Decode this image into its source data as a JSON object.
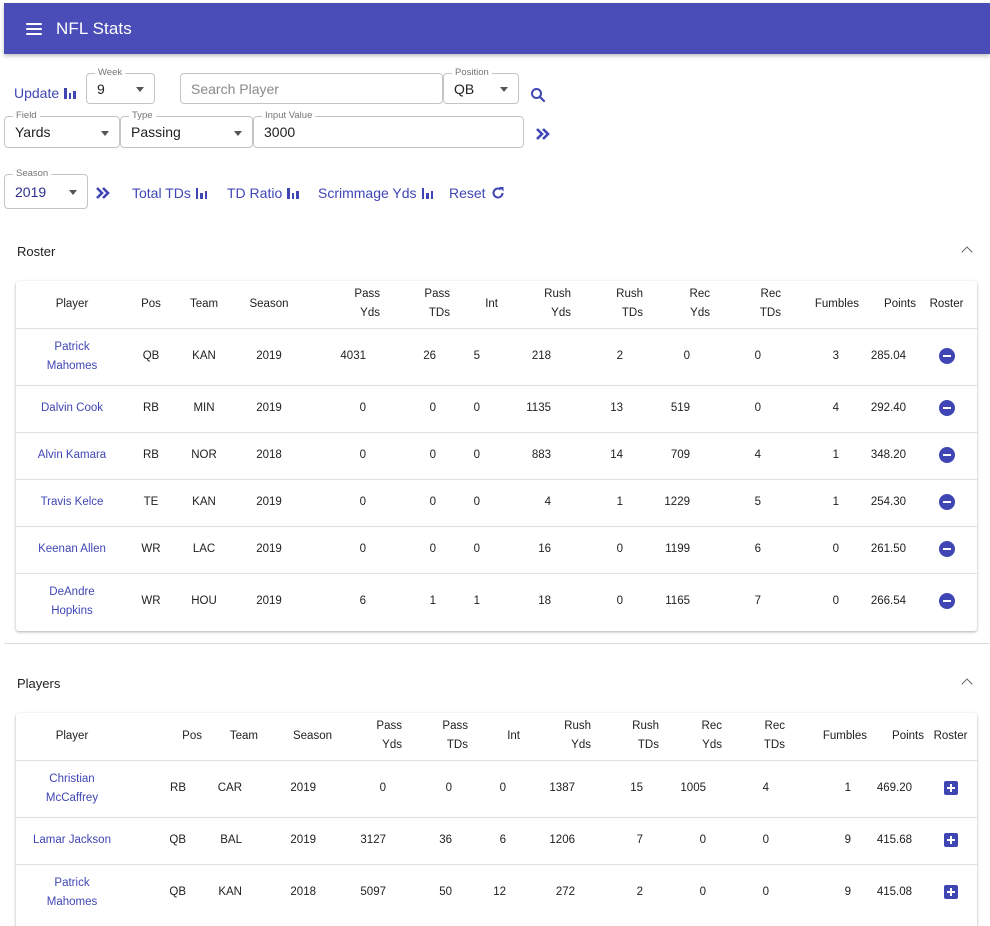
{
  "app": {
    "title": "NFL Stats"
  },
  "controls": {
    "update_label": "Update",
    "week": {
      "label": "Week",
      "value": "9"
    },
    "search": {
      "placeholder": "Search Player"
    },
    "position": {
      "label": "Position",
      "value": "QB"
    },
    "field": {
      "label": "Field",
      "value": "Yards"
    },
    "type": {
      "label": "Type",
      "value": "Passing"
    },
    "input_value": {
      "label": "Input Value",
      "value": "3000"
    },
    "season": {
      "label": "Season",
      "value": "2019"
    },
    "total_tds_label": "Total TDs",
    "td_ratio_label": "TD Ratio",
    "scrimmage_yds_label": "Scrimmage Yds",
    "reset_label": "Reset"
  },
  "columns": {
    "player": "Player",
    "pos": "Pos",
    "team": "Team",
    "season": "Season",
    "pass_yds_1": "Pass",
    "pass_yds_2": "Yds",
    "pass_tds_1": "Pass",
    "pass_tds_2": "TDs",
    "int": "Int",
    "rush_yds_1": "Rush",
    "rush_yds_2": "Yds",
    "rush_tds_1": "Rush",
    "rush_tds_2": "TDs",
    "rec_yds_1": "Rec",
    "rec_yds_2": "Yds",
    "rec_tds_1": "Rec",
    "rec_tds_2": "TDs",
    "fumbles": "Fumbles",
    "points": "Points",
    "roster": "Roster"
  },
  "roster": {
    "title": "Roster",
    "rows": [
      {
        "name1": "Patrick",
        "name2": "Mahomes",
        "pos": "QB",
        "team": "KAN",
        "season": "2019",
        "pass_yds": "4031",
        "pass_tds": "26",
        "int": "5",
        "rush_yds": "218",
        "rush_tds": "2",
        "rec_yds": "0",
        "rec_tds": "0",
        "fumbles": "3",
        "points": "285.04"
      },
      {
        "name1": "Dalvin Cook",
        "name2": "",
        "pos": "RB",
        "team": "MIN",
        "season": "2019",
        "pass_yds": "0",
        "pass_tds": "0",
        "int": "0",
        "rush_yds": "1135",
        "rush_tds": "13",
        "rec_yds": "519",
        "rec_tds": "0",
        "fumbles": "4",
        "points": "292.40"
      },
      {
        "name1": "Alvin Kamara",
        "name2": "",
        "pos": "RB",
        "team": "NOR",
        "season": "2018",
        "pass_yds": "0",
        "pass_tds": "0",
        "int": "0",
        "rush_yds": "883",
        "rush_tds": "14",
        "rec_yds": "709",
        "rec_tds": "4",
        "fumbles": "1",
        "points": "348.20"
      },
      {
        "name1": "Travis Kelce",
        "name2": "",
        "pos": "TE",
        "team": "KAN",
        "season": "2019",
        "pass_yds": "0",
        "pass_tds": "0",
        "int": "0",
        "rush_yds": "4",
        "rush_tds": "1",
        "rec_yds": "1229",
        "rec_tds": "5",
        "fumbles": "1",
        "points": "254.30"
      },
      {
        "name1": "Keenan Allen",
        "name2": "",
        "pos": "WR",
        "team": "LAC",
        "season": "2019",
        "pass_yds": "0",
        "pass_tds": "0",
        "int": "0",
        "rush_yds": "16",
        "rush_tds": "0",
        "rec_yds": "1199",
        "rec_tds": "6",
        "fumbles": "0",
        "points": "261.50"
      },
      {
        "name1": "DeAndre",
        "name2": "Hopkins",
        "pos": "WR",
        "team": "HOU",
        "season": "2019",
        "pass_yds": "6",
        "pass_tds": "1",
        "int": "1",
        "rush_yds": "18",
        "rush_tds": "0",
        "rec_yds": "1165",
        "rec_tds": "7",
        "fumbles": "0",
        "points": "266.54"
      }
    ]
  },
  "players": {
    "title": "Players",
    "rows": [
      {
        "name1": "Christian",
        "name2": "McCaffrey",
        "pos": "RB",
        "team": "CAR",
        "season": "2019",
        "pass_yds": "0",
        "pass_tds": "0",
        "int": "0",
        "rush_yds": "1387",
        "rush_tds": "15",
        "rec_yds": "1005",
        "rec_tds": "4",
        "fumbles": "1",
        "points": "469.20"
      },
      {
        "name1": "Lamar Jackson",
        "name2": "",
        "pos": "QB",
        "team": "BAL",
        "season": "2019",
        "pass_yds": "3127",
        "pass_tds": "36",
        "int": "6",
        "rush_yds": "1206",
        "rush_tds": "7",
        "rec_yds": "0",
        "rec_tds": "0",
        "fumbles": "9",
        "points": "415.68"
      },
      {
        "name1": "Patrick",
        "name2": "Mahomes",
        "pos": "QB",
        "team": "KAN",
        "season": "2018",
        "pass_yds": "5097",
        "pass_tds": "50",
        "int": "12",
        "rush_yds": "272",
        "rush_tds": "2",
        "rec_yds": "0",
        "rec_tds": "0",
        "fumbles": "9",
        "points": "415.08"
      }
    ]
  },
  "colors": {
    "primary": "#4a4db8",
    "accent": "#3f46b4"
  }
}
